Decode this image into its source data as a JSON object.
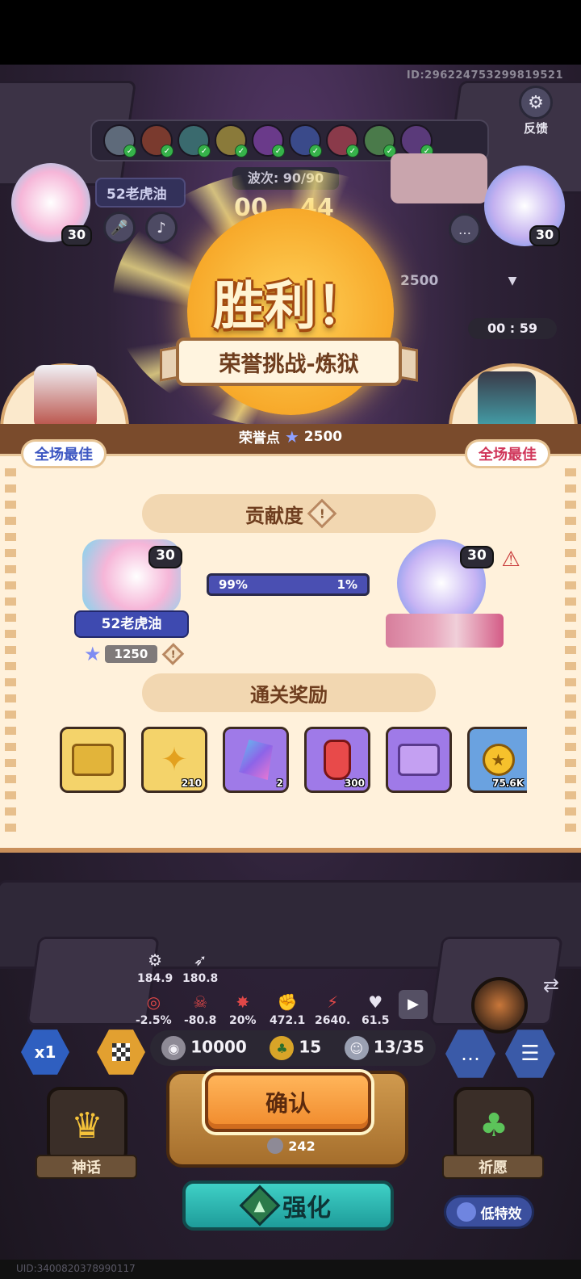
{
  "header": {
    "player_id": "ID:2962247532998195​21"
  },
  "top_right": {
    "feedback_label": "反馈"
  },
  "battle": {
    "wave_label": "波次: 90/90",
    "timer_left": "00",
    "timer_right": "44",
    "left_player": {
      "name": "52老虎油",
      "level": "30"
    },
    "right_player": {
      "level": "30"
    },
    "right_score": "2500",
    "countdown": "00 : 59"
  },
  "result": {
    "title": "胜利！",
    "mode": "荣誉挑战-炼狱",
    "honor_label": "荣誉点",
    "honor_value": "2500",
    "best_left": "全场最佳",
    "best_right": "全场最佳"
  },
  "contribution": {
    "title": "贡献度",
    "left": {
      "name": "52老虎油",
      "level": "30",
      "points": "1250",
      "percent": "99%"
    },
    "right": {
      "level": "30",
      "percent": "1%"
    },
    "left_share": 0.99
  },
  "rewards": {
    "title": "通关奖励",
    "items": [
      {
        "name": "gold-chest",
        "count": ""
      },
      {
        "name": "golden-key",
        "count": "210"
      },
      {
        "name": "crystal",
        "count": "2"
      },
      {
        "name": "potion",
        "count": "300"
      },
      {
        "name": "purple-chest",
        "count": ""
      },
      {
        "name": "gold-coin",
        "count": "75.6K"
      }
    ]
  },
  "stats": [
    {
      "icon": "speed-icon",
      "value": "184.9"
    },
    {
      "icon": "wing-icon",
      "value": "180.8"
    },
    {
      "icon": "target-icon",
      "value": "-2.5%"
    },
    {
      "icon": "skull-icon",
      "value": "-80.8"
    },
    {
      "icon": "burst-icon",
      "value": "20%"
    },
    {
      "icon": "fist-icon",
      "value": "472.1"
    },
    {
      "icon": "crit-icon",
      "value": "2640."
    },
    {
      "icon": "heart-icon",
      "value": "61.5"
    }
  ],
  "resources": {
    "silver": "10000",
    "clover": "15",
    "units": "13/35"
  },
  "hud": {
    "speed_label": "x1",
    "confirm_label": "确认",
    "cost_value": "242",
    "enhance_label": "强化",
    "myth_label": "神话",
    "pray_label": "祈愿",
    "low_fx_label": "低特效",
    "bottom_id": "UID:3400820378990117"
  }
}
